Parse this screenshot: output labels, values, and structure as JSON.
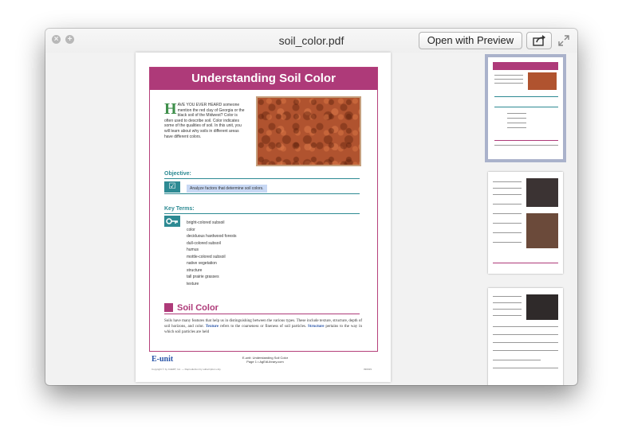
{
  "window": {
    "title": "soil_color.pdf",
    "open_with_preview": "Open with Preview",
    "close_symbol": "×",
    "zoom_symbol": "+"
  },
  "icons": {
    "share": "share-icon",
    "expand": "expand-icon",
    "check": "checkbox-icon",
    "key": "key-icon"
  },
  "colors": {
    "banner": "#ae3a79",
    "teal": "#2d8a93",
    "highlight": "#c8d8f4",
    "selected_thumb": "#aab2cb"
  },
  "document": {
    "banner_title": "Understanding Soil Color",
    "intro_dropcap": "H",
    "intro_text": "AVE YOU EVER HEARD someone mention the red clay of Georgia or the black soil of the Midwest? Color is often used to describe soil. Color indicates some of the qualities of soil. In this unit, you will learn about why soils in different areas have different colors.",
    "objective_heading": "Objective:",
    "objective_text": "Analyze factors that determine soil colors.",
    "key_terms_heading": "Key Terms:",
    "key_terms": [
      "bright-colored subsoil",
      "color",
      "deciduous hardwood forests",
      "dull-colored subsoil",
      "humus",
      "mottle-colored subsoil",
      "native vegetation",
      "structure",
      "tall prairie grasses",
      "texture"
    ],
    "soil_color_heading": "Soil Color",
    "body_part1": "Soils have many features that help us in distinguishing between the various types. These include texture, structure, depth of soil horizons, and color.",
    "body_term1": "Texture",
    "body_part2": "refers to the coarseness or fineness of soil particles.",
    "body_term2": "Structure",
    "body_part3": "pertains to the way in which soil particles are held",
    "footer_logo": "E-unit",
    "footer_line1": "E-unit: Understanding Soil Color",
    "footer_line2": "Page 1  •  AgEdLibrary.com",
    "footer_copyright": "Copyright © by CAERT, Inc.  —  Reproduction by subscription only.",
    "footer_code": "090029"
  }
}
